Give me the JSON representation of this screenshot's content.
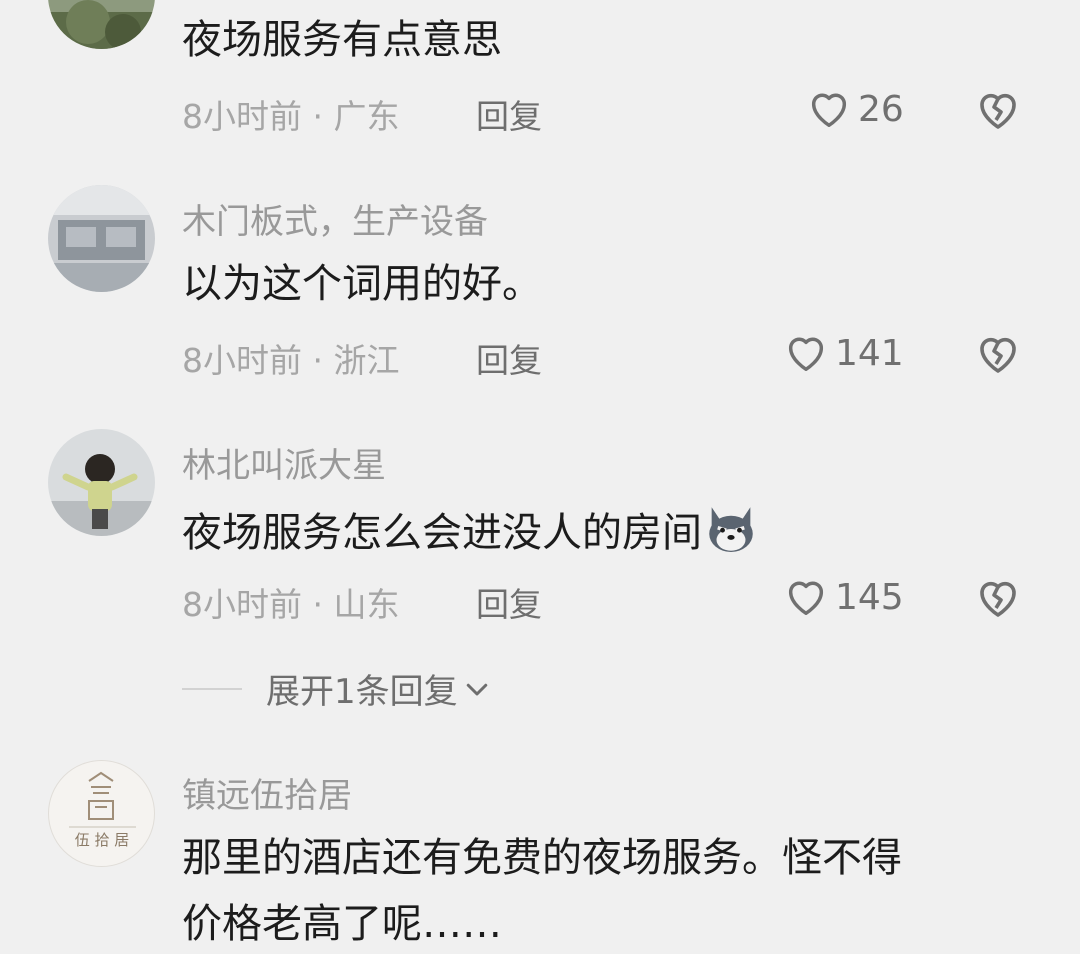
{
  "comments": [
    {
      "name": "",
      "text": "夜场服务有点意思",
      "time_location": "8小时前 · 广东",
      "reply_label": "回复",
      "likes": "26"
    },
    {
      "name": "木门板式，生产设备",
      "text": "以为这个词用的好。",
      "time_location": "8小时前 · 浙江",
      "reply_label": "回复",
      "likes": "141"
    },
    {
      "name": "林北叫派大星",
      "text": "夜场服务怎么会进没人的房间",
      "emoji": "husky-emoji",
      "time_location": "8小时前 · 山东",
      "reply_label": "回复",
      "likes": "145",
      "expand_label": "展开1条回复"
    },
    {
      "name": "镇远伍拾居",
      "avatar_logo_text": "伍 拾 居",
      "text_line1": "那里的酒店还有免费的夜场服务。怪不得",
      "text_line2": "价格老高了呢……"
    }
  ],
  "colors": {
    "background": "#f0f0f0",
    "text": "#1c1c1c",
    "secondary": "#a6a6a6",
    "icon": "#707070"
  },
  "icons": [
    "heart-outline-icon",
    "broken-heart-icon",
    "chevron-down-icon"
  ]
}
